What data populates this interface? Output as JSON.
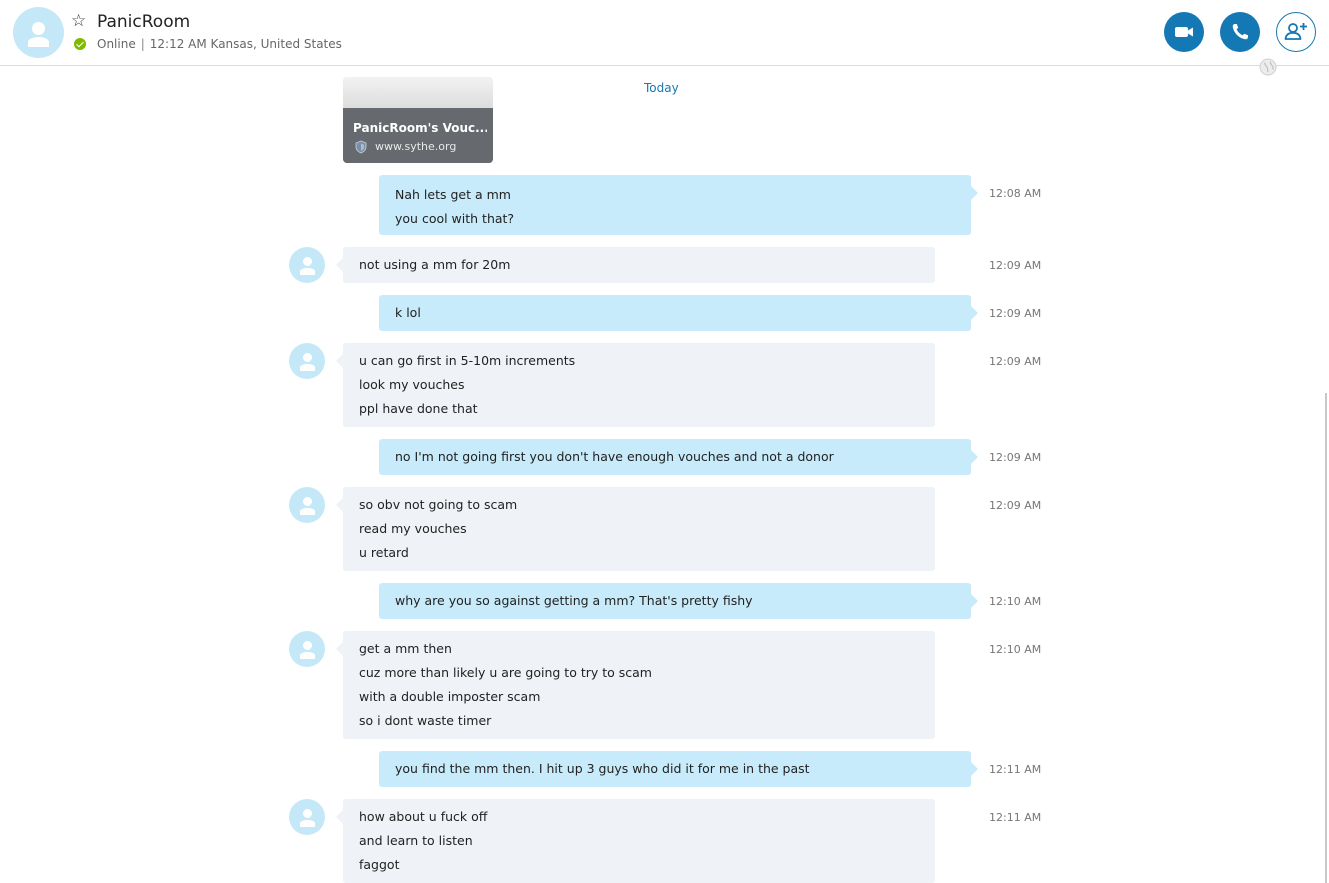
{
  "header": {
    "contact_name": "PanicRoom",
    "status": "Online",
    "local_time": "12:12 AM Kansas, United States",
    "separator": "|",
    "icons": {
      "favorite": "star-outline-icon",
      "status": "online-check-icon",
      "video": "video-camera-icon",
      "call": "phone-icon",
      "add_people": "add-person-icon",
      "globe": "globe-icon"
    },
    "colors": {
      "accent": "#1478b4",
      "online": "#7fba00",
      "avatar": "#c5e8f8"
    }
  },
  "chat": {
    "link_preview": {
      "title": "PanicRoom's Vouc...",
      "url": "www.sythe.org",
      "icon": "shield-icon"
    },
    "date_divider": "Today",
    "colors": {
      "outgoing_bubble": "#c7ebfa",
      "incoming_bubble": "#eff2f6"
    },
    "messages": [
      {
        "direction": "outgoing",
        "time": "12:08 AM",
        "lines": [
          "Nah lets get a mm",
          "you cool with that?"
        ]
      },
      {
        "direction": "incoming",
        "time": "12:09 AM",
        "lines": [
          "not using a mm for 20m"
        ]
      },
      {
        "direction": "outgoing",
        "time": "12:09 AM",
        "lines": [
          "k lol"
        ]
      },
      {
        "direction": "incoming",
        "time": "12:09 AM",
        "lines": [
          "u can go first in 5-10m increments",
          "look my vouches",
          "ppl have done that"
        ]
      },
      {
        "direction": "outgoing",
        "time": "12:09 AM",
        "lines": [
          "no I'm not going first you don't have enough vouches and not a donor"
        ]
      },
      {
        "direction": "incoming",
        "time": "12:09 AM",
        "lines": [
          "so obv not going to scam",
          "read my vouches",
          "u retard"
        ]
      },
      {
        "direction": "outgoing",
        "time": "12:10 AM",
        "lines": [
          "why are you so against getting a mm? That's pretty fishy"
        ]
      },
      {
        "direction": "incoming",
        "time": "12:10 AM",
        "lines": [
          "get a mm then",
          "cuz more than likely u are going to try to scam",
          "with a double imposter scam",
          "so i dont waste timer"
        ]
      },
      {
        "direction": "outgoing",
        "time": "12:11 AM",
        "lines": [
          "you find the mm then. I hit up 3 guys who did it for me in the past"
        ]
      },
      {
        "direction": "incoming",
        "time": "12:11 AM",
        "lines": [
          "how about u fuck off",
          "and learn to listen",
          "faggot"
        ]
      }
    ]
  }
}
